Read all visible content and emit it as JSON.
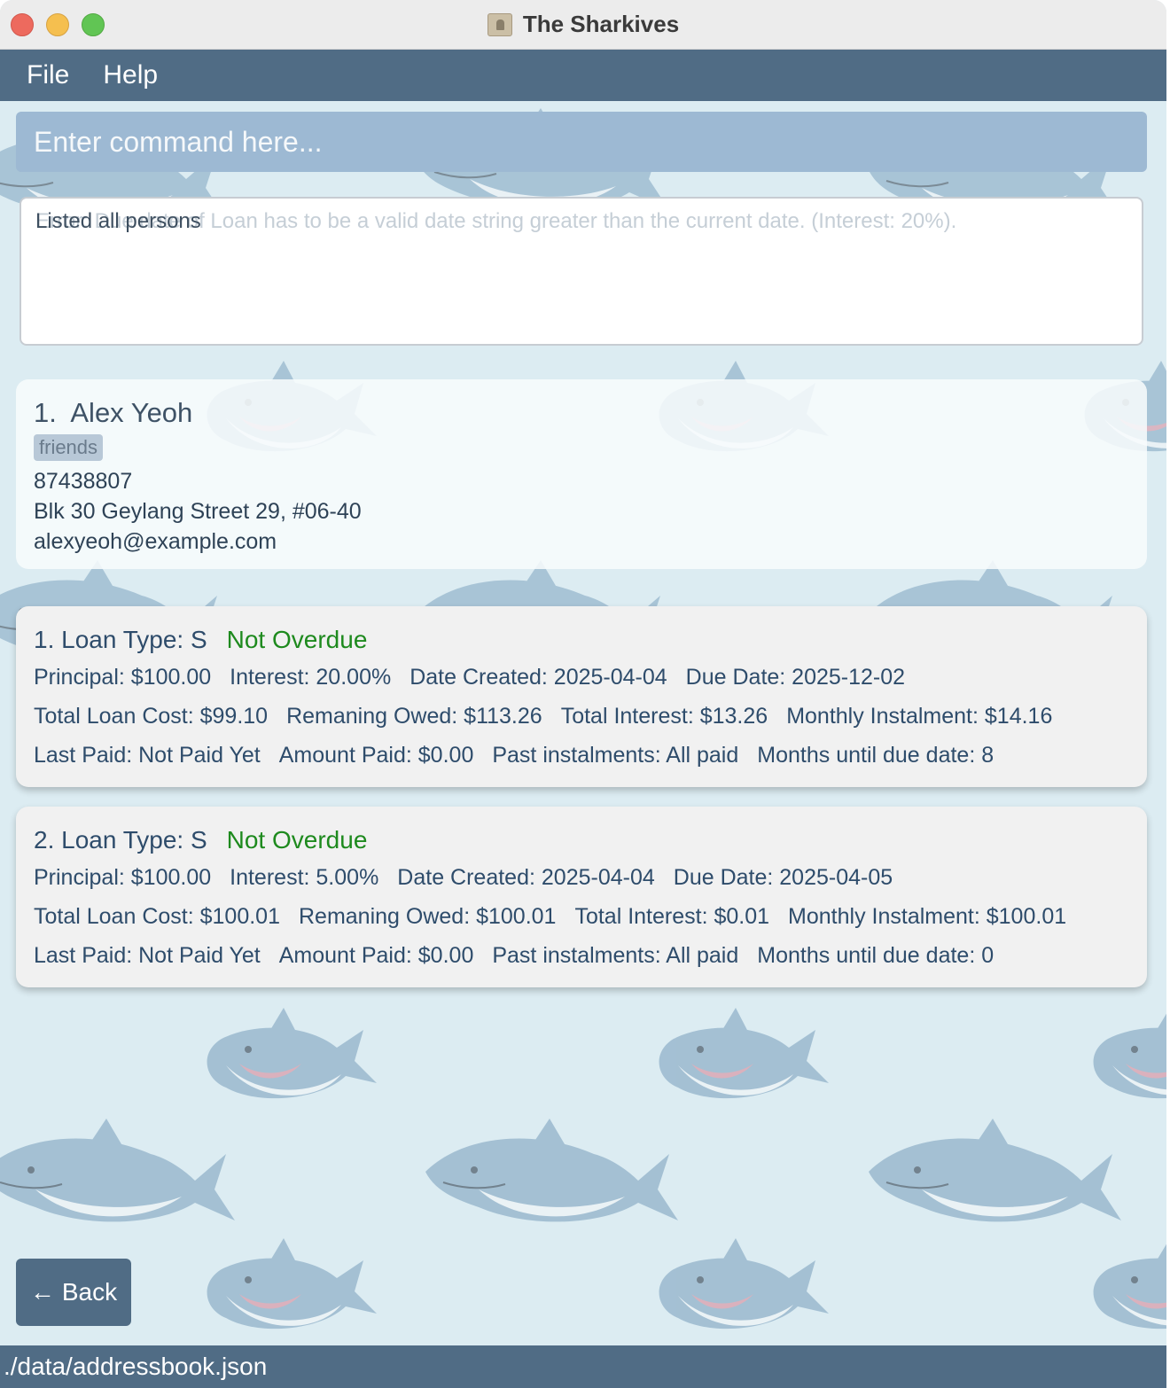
{
  "window": {
    "title": "The Sharkives"
  },
  "menu": {
    "items": [
      "File",
      "Help"
    ]
  },
  "command": {
    "placeholder": "Enter command here..."
  },
  "result": {
    "message": "Listed all persons",
    "ghost_text": "Error: Due date of Loan has to be a valid date string greater than the current date. (Interest: 20%)."
  },
  "person": {
    "index": "1.",
    "name": "Alex Yeoh",
    "tag": "friends",
    "phone": "87438807",
    "address": "Blk 30 Geylang Street 29, #06-40",
    "email": "alexyeoh@example.com"
  },
  "loans": [
    {
      "header": "1. Loan Type: S",
      "status": "Not Overdue",
      "principal": "Principal: $100.00",
      "interest": "Interest: 20.00%",
      "date_created": "Date Created: 2025-04-04",
      "due_date": "Due Date: 2025-12-02",
      "total_cost": "Total Loan Cost: $99.10",
      "remaining_owed": "Remaning Owed: $113.26",
      "total_interest": "Total Interest: $13.26",
      "monthly_instalment": "Monthly Instalment: $14.16",
      "last_paid": "Last Paid: Not Paid Yet",
      "amount_paid": "Amount Paid: $0.00",
      "past_instalments": "Past instalments: All paid",
      "months_until_due": "Months until due date: 8"
    },
    {
      "header": "2. Loan Type: S",
      "status": "Not Overdue",
      "principal": "Principal: $100.00",
      "interest": "Interest: 5.00%",
      "date_created": "Date Created: 2025-04-04",
      "due_date": "Due Date: 2025-04-05",
      "total_cost": "Total Loan Cost: $100.01",
      "remaining_owed": "Remaning Owed: $100.01",
      "total_interest": "Total Interest: $0.01",
      "monthly_instalment": "Monthly Instalment: $100.01",
      "last_paid": "Last Paid: Not Paid Yet",
      "amount_paid": "Amount Paid: $0.00",
      "past_instalments": "Past instalments: All paid",
      "months_until_due": "Months until due date: 0"
    }
  ],
  "back_button": {
    "label": "Back",
    "icon": "arrow-left-icon"
  },
  "statusbar": {
    "path": "./data/addressbook.json"
  },
  "colors": {
    "accent": "#506c85",
    "command_bg": "#9db9d3",
    "status_ok": "#1e8a1e",
    "background": "#dcecf2"
  }
}
